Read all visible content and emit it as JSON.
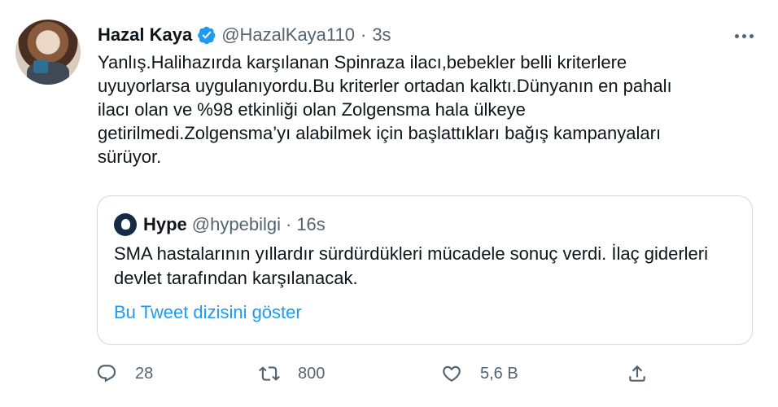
{
  "author": {
    "name": "Hazal Kaya",
    "handle": "@HazalKaya110",
    "separator": "·",
    "time": "3s",
    "verified_icon": "verified-badge-icon"
  },
  "tweet_text": "Yanlış.Halihazırda karşılanan Spinraza ilacı,bebekler belli kriterlere\nuyuyorlarsa uygulanıyordu.Bu kriterler ortadan kalktı.Dünyanın en pahalı\nilacı olan ve %98 etkinliği olan Zolgensma hala ülkeye\ngetirilmedi.Zolgensma’yı alabilmek için başlattıkları bağış kampanyaları\nsürüyor.",
  "quote": {
    "name": "Hype",
    "handle": "@hypebilgi",
    "separator": "·",
    "time": "16s",
    "text": "SMA hastalarının yıllardır sürdürdükleri mücadele sonuç verdi. İlaç giderleri devlet tarafından karşılanacak.",
    "thread_link": "Bu Tweet dizisini göster"
  },
  "actions": {
    "reply_count": "28",
    "retweet_count": "800",
    "like_count": "5,6 B"
  },
  "colors": {
    "accent": "#1d9bf0",
    "secondary_text": "#536471",
    "border": "#cfd9de"
  }
}
